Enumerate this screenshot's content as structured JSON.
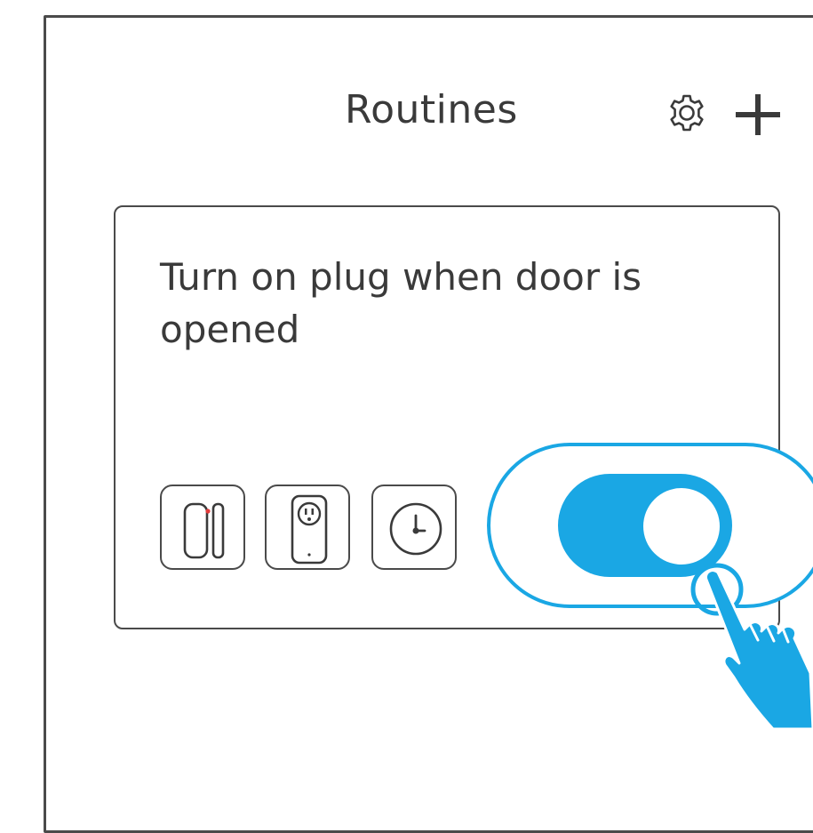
{
  "screen": {
    "title": "Routines",
    "header_icons": [
      "gear-icon",
      "plus-icon"
    ]
  },
  "routine": {
    "title": "Turn on plug when door is opened",
    "devices": [
      "door-sensor-icon",
      "smart-plug-icon",
      "clock-icon"
    ],
    "toggle": {
      "state": "on",
      "color": "#1aa7e4"
    }
  },
  "colors": {
    "accent": "#1aa7e4",
    "text": "#3a3a3a",
    "border": "#4a4a4a",
    "sensor_led": "#e23b3b"
  }
}
